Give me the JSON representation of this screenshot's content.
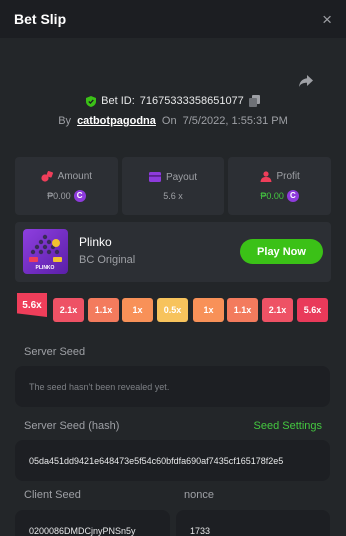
{
  "header": {
    "title": "Bet Slip",
    "close_icon": "×"
  },
  "bet": {
    "id_label": "Bet ID:",
    "id_value": "71675333358651077",
    "by_label": "By",
    "username": "catbotpagodna",
    "on_label": "On",
    "datetime": "7/5/2022, 1:55:31 PM"
  },
  "stats": {
    "amount": {
      "label": "Amount",
      "value": "₱0.00"
    },
    "payout": {
      "label": "Payout",
      "value": "5.6 x"
    },
    "profit": {
      "label": "Profit",
      "value": "₱0.00"
    }
  },
  "game": {
    "name": "Plinko",
    "provider": "BC Original",
    "play_label": "Play Now",
    "thumb_label": "PLINKO"
  },
  "result_flag": "5.6x",
  "multipliers": [
    {
      "label": "2.1x",
      "color": "#ee5265"
    },
    {
      "label": "1.1x",
      "color": "#f37b5d"
    },
    {
      "label": "1x",
      "color": "#f89158"
    },
    {
      "label": "0.5x",
      "color": "#f7c35c"
    },
    {
      "label": "1x",
      "color": "#f89158"
    },
    {
      "label": "1.1x",
      "color": "#f37b5d"
    },
    {
      "label": "2.1x",
      "color": "#ee5265"
    },
    {
      "label": "5.6x",
      "color": "#e93a5a"
    }
  ],
  "server_seed": {
    "label": "Server Seed",
    "value": "The seed hasn't been revealed yet."
  },
  "server_seed_hash": {
    "label": "Server Seed (hash)",
    "settings_label": "Seed Settings",
    "value": "05da451dd9421e648473e5f54c60bfdfa690af7435cf165178f2e5"
  },
  "client_seed": {
    "label": "Client Seed",
    "value": "0200086DMDCjnyPNSn5y"
  },
  "nonce": {
    "label": "nonce",
    "value": "1733"
  },
  "colors": {
    "accent_green": "#3bc117",
    "background": "#232629",
    "card": "#2c2f34",
    "input": "#1d1f23"
  }
}
